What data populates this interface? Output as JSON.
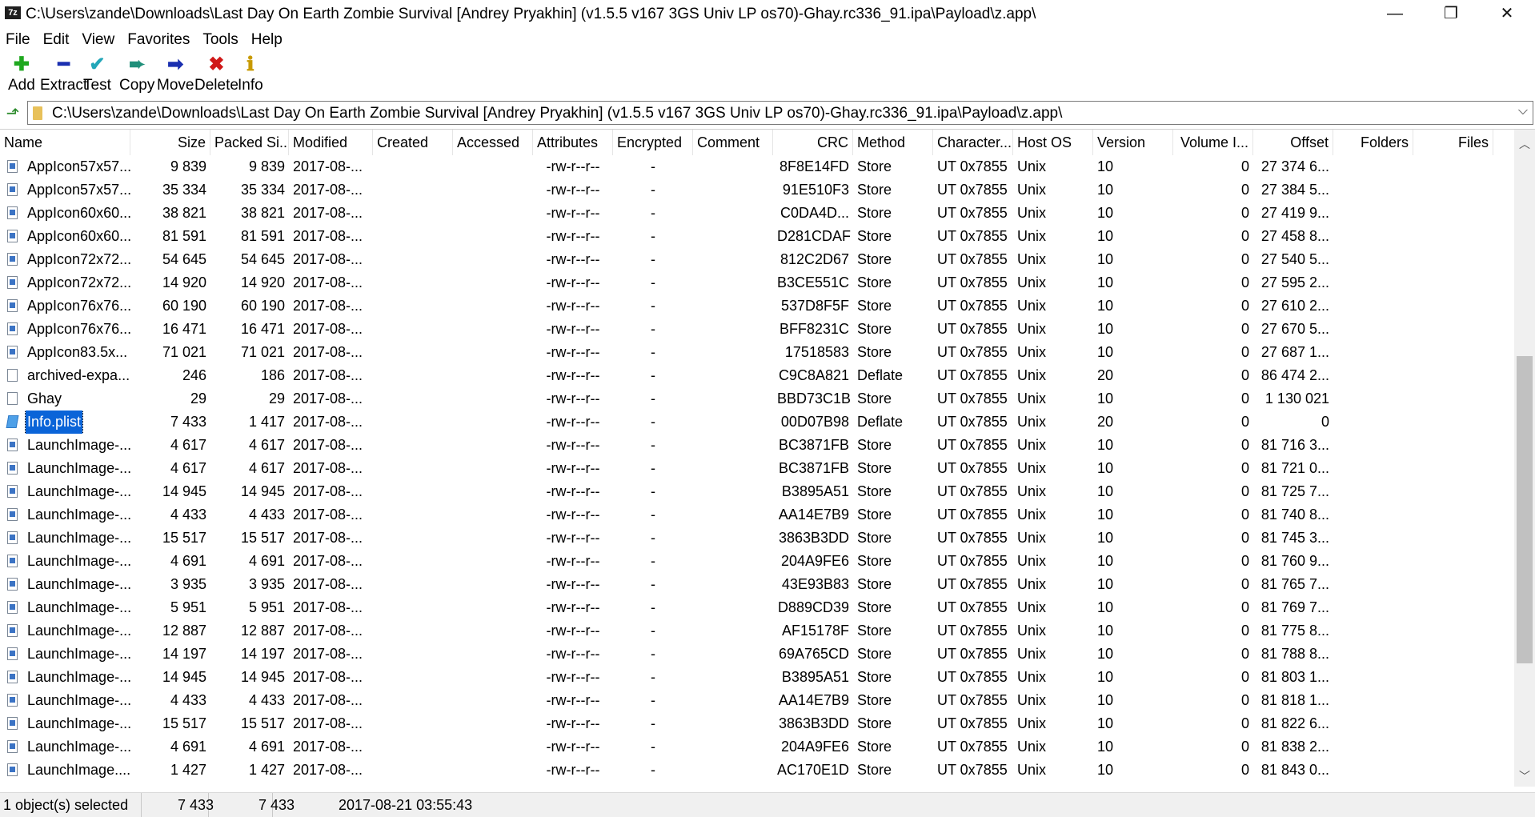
{
  "window": {
    "icon_text": "7z",
    "title": "C:\\Users\\zande\\Downloads\\Last Day On Earth Zombie Survival [Andrey Pryakhin] (v1.5.5 v167 3GS Univ LP os70)-Ghay.rc336_91.ipa\\Payload\\z.app\\",
    "minimize": "—",
    "maximize": "❐",
    "close": "✕"
  },
  "menu": [
    "File",
    "Edit",
    "View",
    "Favorites",
    "Tools",
    "Help"
  ],
  "toolbar": [
    {
      "label": "Add",
      "icon": "add-icon",
      "glyph": "✚",
      "color": "#1fa81f"
    },
    {
      "label": "Extract",
      "icon": "extract-icon",
      "glyph": "━",
      "color": "#1a2fb0"
    },
    {
      "label": "Test",
      "icon": "test-icon",
      "glyph": "✔",
      "color": "#22a6b8"
    },
    {
      "label": "Copy",
      "icon": "copy-icon",
      "glyph": "➨",
      "color": "#1f8f7a"
    },
    {
      "label": "Move",
      "icon": "move-icon",
      "glyph": "➡",
      "color": "#1a2fb0"
    },
    {
      "label": "Delete",
      "icon": "delete-icon",
      "glyph": "✖",
      "color": "#d01818"
    },
    {
      "label": "Info",
      "icon": "info-icon",
      "glyph": "ℹ",
      "color": "#c89a00"
    }
  ],
  "address": {
    "path": "C:\\Users\\zande\\Downloads\\Last Day On Earth Zombie Survival [Andrey Pryakhin] (v1.5.5 v167 3GS Univ LP os70)-Ghay.rc336_91.ipa\\Payload\\z.app\\",
    "dropdown": "⌵"
  },
  "columns": [
    "Name",
    "Size",
    "Packed Si...",
    "Modified",
    "Created",
    "Accessed",
    "Attributes",
    "Encrypted",
    "Comment",
    "CRC",
    "Method",
    "Character...",
    "Host OS",
    "Version",
    "Volume I...",
    "Offset",
    "Folders",
    "Files"
  ],
  "files": [
    {
      "icon": "img",
      "name": "AppIcon57x57...",
      "size": "9 839",
      "packed": "9 839",
      "modified": "2017-08-...",
      "attributes": "-rw-r--r--",
      "encrypted": "-",
      "crc": "8F8E14FD",
      "method": "Store",
      "chars": "UT 0x7855",
      "host": "Unix",
      "version": "10",
      "volume": "0",
      "offset": "27 374 6..."
    },
    {
      "icon": "img",
      "name": "AppIcon57x57...",
      "size": "35 334",
      "packed": "35 334",
      "modified": "2017-08-...",
      "attributes": "-rw-r--r--",
      "encrypted": "-",
      "crc": "91E510F3",
      "method": "Store",
      "chars": "UT 0x7855",
      "host": "Unix",
      "version": "10",
      "volume": "0",
      "offset": "27 384 5..."
    },
    {
      "icon": "img",
      "name": "AppIcon60x60...",
      "size": "38 821",
      "packed": "38 821",
      "modified": "2017-08-...",
      "attributes": "-rw-r--r--",
      "encrypted": "-",
      "crc": "C0DA4D...",
      "method": "Store",
      "chars": "UT 0x7855",
      "host": "Unix",
      "version": "10",
      "volume": "0",
      "offset": "27 419 9..."
    },
    {
      "icon": "img",
      "name": "AppIcon60x60...",
      "size": "81 591",
      "packed": "81 591",
      "modified": "2017-08-...",
      "attributes": "-rw-r--r--",
      "encrypted": "-",
      "crc": "D281CDAF",
      "method": "Store",
      "chars": "UT 0x7855",
      "host": "Unix",
      "version": "10",
      "volume": "0",
      "offset": "27 458 8..."
    },
    {
      "icon": "img",
      "name": "AppIcon72x72...",
      "size": "54 645",
      "packed": "54 645",
      "modified": "2017-08-...",
      "attributes": "-rw-r--r--",
      "encrypted": "-",
      "crc": "812C2D67",
      "method": "Store",
      "chars": "UT 0x7855",
      "host": "Unix",
      "version": "10",
      "volume": "0",
      "offset": "27 540 5..."
    },
    {
      "icon": "img",
      "name": "AppIcon72x72...",
      "size": "14 920",
      "packed": "14 920",
      "modified": "2017-08-...",
      "attributes": "-rw-r--r--",
      "encrypted": "-",
      "crc": "B3CE551C",
      "method": "Store",
      "chars": "UT 0x7855",
      "host": "Unix",
      "version": "10",
      "volume": "0",
      "offset": "27 595 2..."
    },
    {
      "icon": "img",
      "name": "AppIcon76x76...",
      "size": "60 190",
      "packed": "60 190",
      "modified": "2017-08-...",
      "attributes": "-rw-r--r--",
      "encrypted": "-",
      "crc": "537D8F5F",
      "method": "Store",
      "chars": "UT 0x7855",
      "host": "Unix",
      "version": "10",
      "volume": "0",
      "offset": "27 610 2..."
    },
    {
      "icon": "img",
      "name": "AppIcon76x76...",
      "size": "16 471",
      "packed": "16 471",
      "modified": "2017-08-...",
      "attributes": "-rw-r--r--",
      "encrypted": "-",
      "crc": "BFF8231C",
      "method": "Store",
      "chars": "UT 0x7855",
      "host": "Unix",
      "version": "10",
      "volume": "0",
      "offset": "27 670 5..."
    },
    {
      "icon": "img",
      "name": "AppIcon83.5x...",
      "size": "71 021",
      "packed": "71 021",
      "modified": "2017-08-...",
      "attributes": "-rw-r--r--",
      "encrypted": "-",
      "crc": "17518583",
      "method": "Store",
      "chars": "UT 0x7855",
      "host": "Unix",
      "version": "10",
      "volume": "0",
      "offset": "27 687 1..."
    },
    {
      "icon": "doc",
      "name": "archived-expa...",
      "size": "246",
      "packed": "186",
      "modified": "2017-08-...",
      "attributes": "-rw-r--r--",
      "encrypted": "-",
      "crc": "C9C8A821",
      "method": "Deflate",
      "chars": "UT 0x7855",
      "host": "Unix",
      "version": "20",
      "volume": "0",
      "offset": "86 474 2..."
    },
    {
      "icon": "doc",
      "name": "Ghay",
      "size": "29",
      "packed": "29",
      "modified": "2017-08-...",
      "attributes": "-rw-r--r--",
      "encrypted": "-",
      "crc": "BBD73C1B",
      "method": "Store",
      "chars": "UT 0x7855",
      "host": "Unix",
      "version": "10",
      "volume": "0",
      "offset": "1 130 021"
    },
    {
      "icon": "plist",
      "name": "Info.plist",
      "size": "7 433",
      "packed": "1 417",
      "modified": "2017-08-...",
      "attributes": "-rw-r--r--",
      "encrypted": "-",
      "crc": "00D07B98",
      "method": "Deflate",
      "chars": "UT 0x7855",
      "host": "Unix",
      "version": "20",
      "volume": "0",
      "offset": "0",
      "selected": true
    },
    {
      "icon": "img",
      "name": "LaunchImage-...",
      "size": "4 617",
      "packed": "4 617",
      "modified": "2017-08-...",
      "attributes": "-rw-r--r--",
      "encrypted": "-",
      "crc": "BC3871FB",
      "method": "Store",
      "chars": "UT 0x7855",
      "host": "Unix",
      "version": "10",
      "volume": "0",
      "offset": "81 716 3..."
    },
    {
      "icon": "img",
      "name": "LaunchImage-...",
      "size": "4 617",
      "packed": "4 617",
      "modified": "2017-08-...",
      "attributes": "-rw-r--r--",
      "encrypted": "-",
      "crc": "BC3871FB",
      "method": "Store",
      "chars": "UT 0x7855",
      "host": "Unix",
      "version": "10",
      "volume": "0",
      "offset": "81 721 0..."
    },
    {
      "icon": "img",
      "name": "LaunchImage-...",
      "size": "14 945",
      "packed": "14 945",
      "modified": "2017-08-...",
      "attributes": "-rw-r--r--",
      "encrypted": "-",
      "crc": "B3895A51",
      "method": "Store",
      "chars": "UT 0x7855",
      "host": "Unix",
      "version": "10",
      "volume": "0",
      "offset": "81 725 7..."
    },
    {
      "icon": "img",
      "name": "LaunchImage-...",
      "size": "4 433",
      "packed": "4 433",
      "modified": "2017-08-...",
      "attributes": "-rw-r--r--",
      "encrypted": "-",
      "crc": "AA14E7B9",
      "method": "Store",
      "chars": "UT 0x7855",
      "host": "Unix",
      "version": "10",
      "volume": "0",
      "offset": "81 740 8..."
    },
    {
      "icon": "img",
      "name": "LaunchImage-...",
      "size": "15 517",
      "packed": "15 517",
      "modified": "2017-08-...",
      "attributes": "-rw-r--r--",
      "encrypted": "-",
      "crc": "3863B3DD",
      "method": "Store",
      "chars": "UT 0x7855",
      "host": "Unix",
      "version": "10",
      "volume": "0",
      "offset": "81 745 3..."
    },
    {
      "icon": "img",
      "name": "LaunchImage-...",
      "size": "4 691",
      "packed": "4 691",
      "modified": "2017-08-...",
      "attributes": "-rw-r--r--",
      "encrypted": "-",
      "crc": "204A9FE6",
      "method": "Store",
      "chars": "UT 0x7855",
      "host": "Unix",
      "version": "10",
      "volume": "0",
      "offset": "81 760 9..."
    },
    {
      "icon": "img",
      "name": "LaunchImage-...",
      "size": "3 935",
      "packed": "3 935",
      "modified": "2017-08-...",
      "attributes": "-rw-r--r--",
      "encrypted": "-",
      "crc": "43E93B83",
      "method": "Store",
      "chars": "UT 0x7855",
      "host": "Unix",
      "version": "10",
      "volume": "0",
      "offset": "81 765 7..."
    },
    {
      "icon": "img",
      "name": "LaunchImage-...",
      "size": "5 951",
      "packed": "5 951",
      "modified": "2017-08-...",
      "attributes": "-rw-r--r--",
      "encrypted": "-",
      "crc": "D889CD39",
      "method": "Store",
      "chars": "UT 0x7855",
      "host": "Unix",
      "version": "10",
      "volume": "0",
      "offset": "81 769 7..."
    },
    {
      "icon": "img",
      "name": "LaunchImage-...",
      "size": "12 887",
      "packed": "12 887",
      "modified": "2017-08-...",
      "attributes": "-rw-r--r--",
      "encrypted": "-",
      "crc": "AF15178F",
      "method": "Store",
      "chars": "UT 0x7855",
      "host": "Unix",
      "version": "10",
      "volume": "0",
      "offset": "81 775 8..."
    },
    {
      "icon": "img",
      "name": "LaunchImage-...",
      "size": "14 197",
      "packed": "14 197",
      "modified": "2017-08-...",
      "attributes": "-rw-r--r--",
      "encrypted": "-",
      "crc": "69A765CD",
      "method": "Store",
      "chars": "UT 0x7855",
      "host": "Unix",
      "version": "10",
      "volume": "0",
      "offset": "81 788 8..."
    },
    {
      "icon": "img",
      "name": "LaunchImage-...",
      "size": "14 945",
      "packed": "14 945",
      "modified": "2017-08-...",
      "attributes": "-rw-r--r--",
      "encrypted": "-",
      "crc": "B3895A51",
      "method": "Store",
      "chars": "UT 0x7855",
      "host": "Unix",
      "version": "10",
      "volume": "0",
      "offset": "81 803 1..."
    },
    {
      "icon": "img",
      "name": "LaunchImage-...",
      "size": "4 433",
      "packed": "4 433",
      "modified": "2017-08-...",
      "attributes": "-rw-r--r--",
      "encrypted": "-",
      "crc": "AA14E7B9",
      "method": "Store",
      "chars": "UT 0x7855",
      "host": "Unix",
      "version": "10",
      "volume": "0",
      "offset": "81 818 1..."
    },
    {
      "icon": "img",
      "name": "LaunchImage-...",
      "size": "15 517",
      "packed": "15 517",
      "modified": "2017-08-...",
      "attributes": "-rw-r--r--",
      "encrypted": "-",
      "crc": "3863B3DD",
      "method": "Store",
      "chars": "UT 0x7855",
      "host": "Unix",
      "version": "10",
      "volume": "0",
      "offset": "81 822 6..."
    },
    {
      "icon": "img",
      "name": "LaunchImage-...",
      "size": "4 691",
      "packed": "4 691",
      "modified": "2017-08-...",
      "attributes": "-rw-r--r--",
      "encrypted": "-",
      "crc": "204A9FE6",
      "method": "Store",
      "chars": "UT 0x7855",
      "host": "Unix",
      "version": "10",
      "volume": "0",
      "offset": "81 838 2..."
    },
    {
      "icon": "img",
      "name": "LaunchImage....",
      "size": "1 427",
      "packed": "1 427",
      "modified": "2017-08-...",
      "attributes": "-rw-r--r--",
      "encrypted": "-",
      "crc": "AC170E1D",
      "method": "Store",
      "chars": "UT 0x7855",
      "host": "Unix",
      "version": "10",
      "volume": "0",
      "offset": "81 843 0..."
    }
  ],
  "status": {
    "selection": "1 object(s) selected",
    "size": "7 433",
    "packed": "7 433",
    "modified": "2017-08-21 03:55:43"
  },
  "scrollbar": {
    "up": "︿",
    "down": "﹀",
    "position": 0.34
  }
}
